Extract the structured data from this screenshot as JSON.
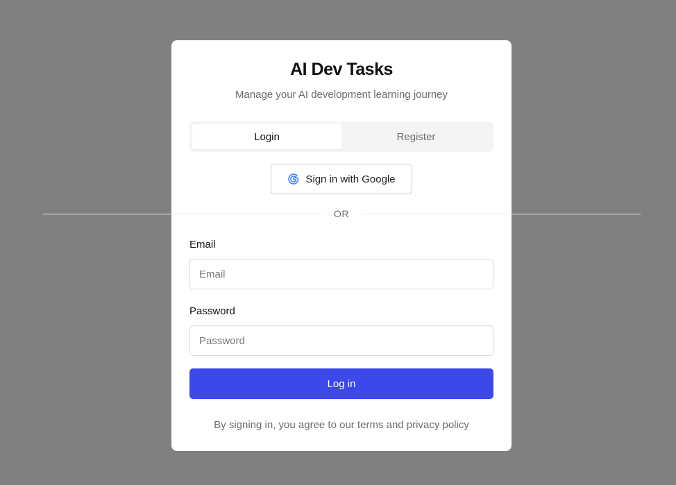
{
  "app": {
    "title": "AI Dev Tasks",
    "subtitle": "Manage your AI development learning journey"
  },
  "tabs": [
    {
      "label": "Login",
      "active": true
    },
    {
      "label": "Register",
      "active": false
    }
  ],
  "google": {
    "label": "Sign in with Google",
    "icon": "google-icon"
  },
  "divider": {
    "label": "OR"
  },
  "form": {
    "email_label": "Email",
    "email_placeholder": "Email",
    "email_value": "",
    "password_label": "Password",
    "password_placeholder": "Password",
    "password_value": "",
    "submit_label": "Log in"
  },
  "footer": {
    "text": "By signing in, you agree to our terms and privacy policy"
  },
  "colors": {
    "backdrop": "#808080",
    "card": "#ffffff",
    "accent": "#3d48e8",
    "google_blue": "#4285f4"
  }
}
